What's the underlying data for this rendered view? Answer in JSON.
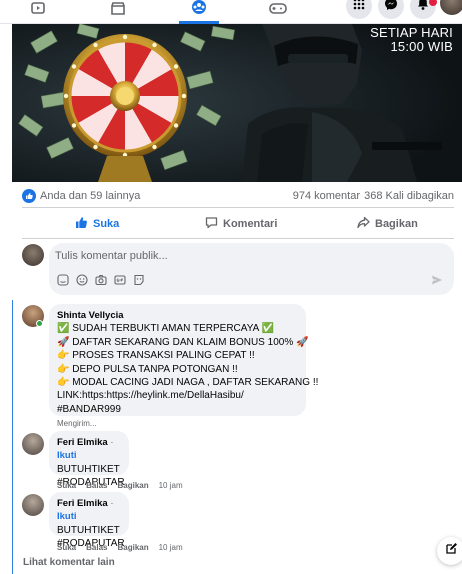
{
  "topnav": {
    "tabs": [
      {
        "name": "watch",
        "icon": "video-icon"
      },
      {
        "name": "marketplace",
        "icon": "store-icon"
      },
      {
        "name": "groups",
        "icon": "groups-icon",
        "active": true
      },
      {
        "name": "gaming",
        "icon": "gamepad-icon"
      }
    ],
    "right": [
      "menu-grid-icon",
      "messenger-icon",
      "notifications-icon",
      "account-avatar"
    ]
  },
  "post": {
    "image_text_line1": "SETIAP HARI",
    "image_text_line2": "15:00 WIB",
    "likes": "Anda dan 59 lainnya",
    "comments_count": "974 komentar",
    "shares_count": "368 Kali dibagikan",
    "actions": {
      "like": "Suka",
      "comment": "Komentari",
      "share": "Bagikan"
    }
  },
  "composer": {
    "placeholder": "Tulis komentar publik..."
  },
  "comments": [
    {
      "author": "Shinta Vellycia",
      "lines": [
        "✅ SUDAH TERBUKTI AMAN TERPERCAYA ✅",
        "🚀 DAFTAR SEKARANG DAN KLAIM BONUS 100% 🚀",
        "👉 PROSES TRANSAKSI PALING CEPAT !!",
        "👉 DEPO PULSA TANPA POTONGAN !!",
        "👉 MODAL CACING JADI NAGA , DAFTAR SEKARANG !!",
        "LINK:https:https://heylink.me/DellaHasibu/",
        "#BANDAR999"
      ],
      "status": "Mengirim..."
    },
    {
      "author": "Feri Elmika",
      "follow": "Ikuti",
      "lines": [
        "BUTUHTIKET",
        "#RODAPUTAR"
      ],
      "like": "Suka",
      "reply": "Balas",
      "share": "Bagikan",
      "time": "10 jam"
    },
    {
      "author": "Feri Elmika",
      "follow": "Ikuti",
      "lines": [
        "BUTUHTIKET",
        "#RODAPUTAR"
      ],
      "like": "Suka",
      "reply": "Balas",
      "share": "Bagikan",
      "time": "10 jam"
    }
  ],
  "more_comments": "Lihat komentar lain",
  "colors": {
    "accent": "#1b74e4",
    "bubble": "#f0f2f5",
    "muted": "#65676b",
    "online": "#31a24c",
    "notification": "#e41e3f"
  }
}
